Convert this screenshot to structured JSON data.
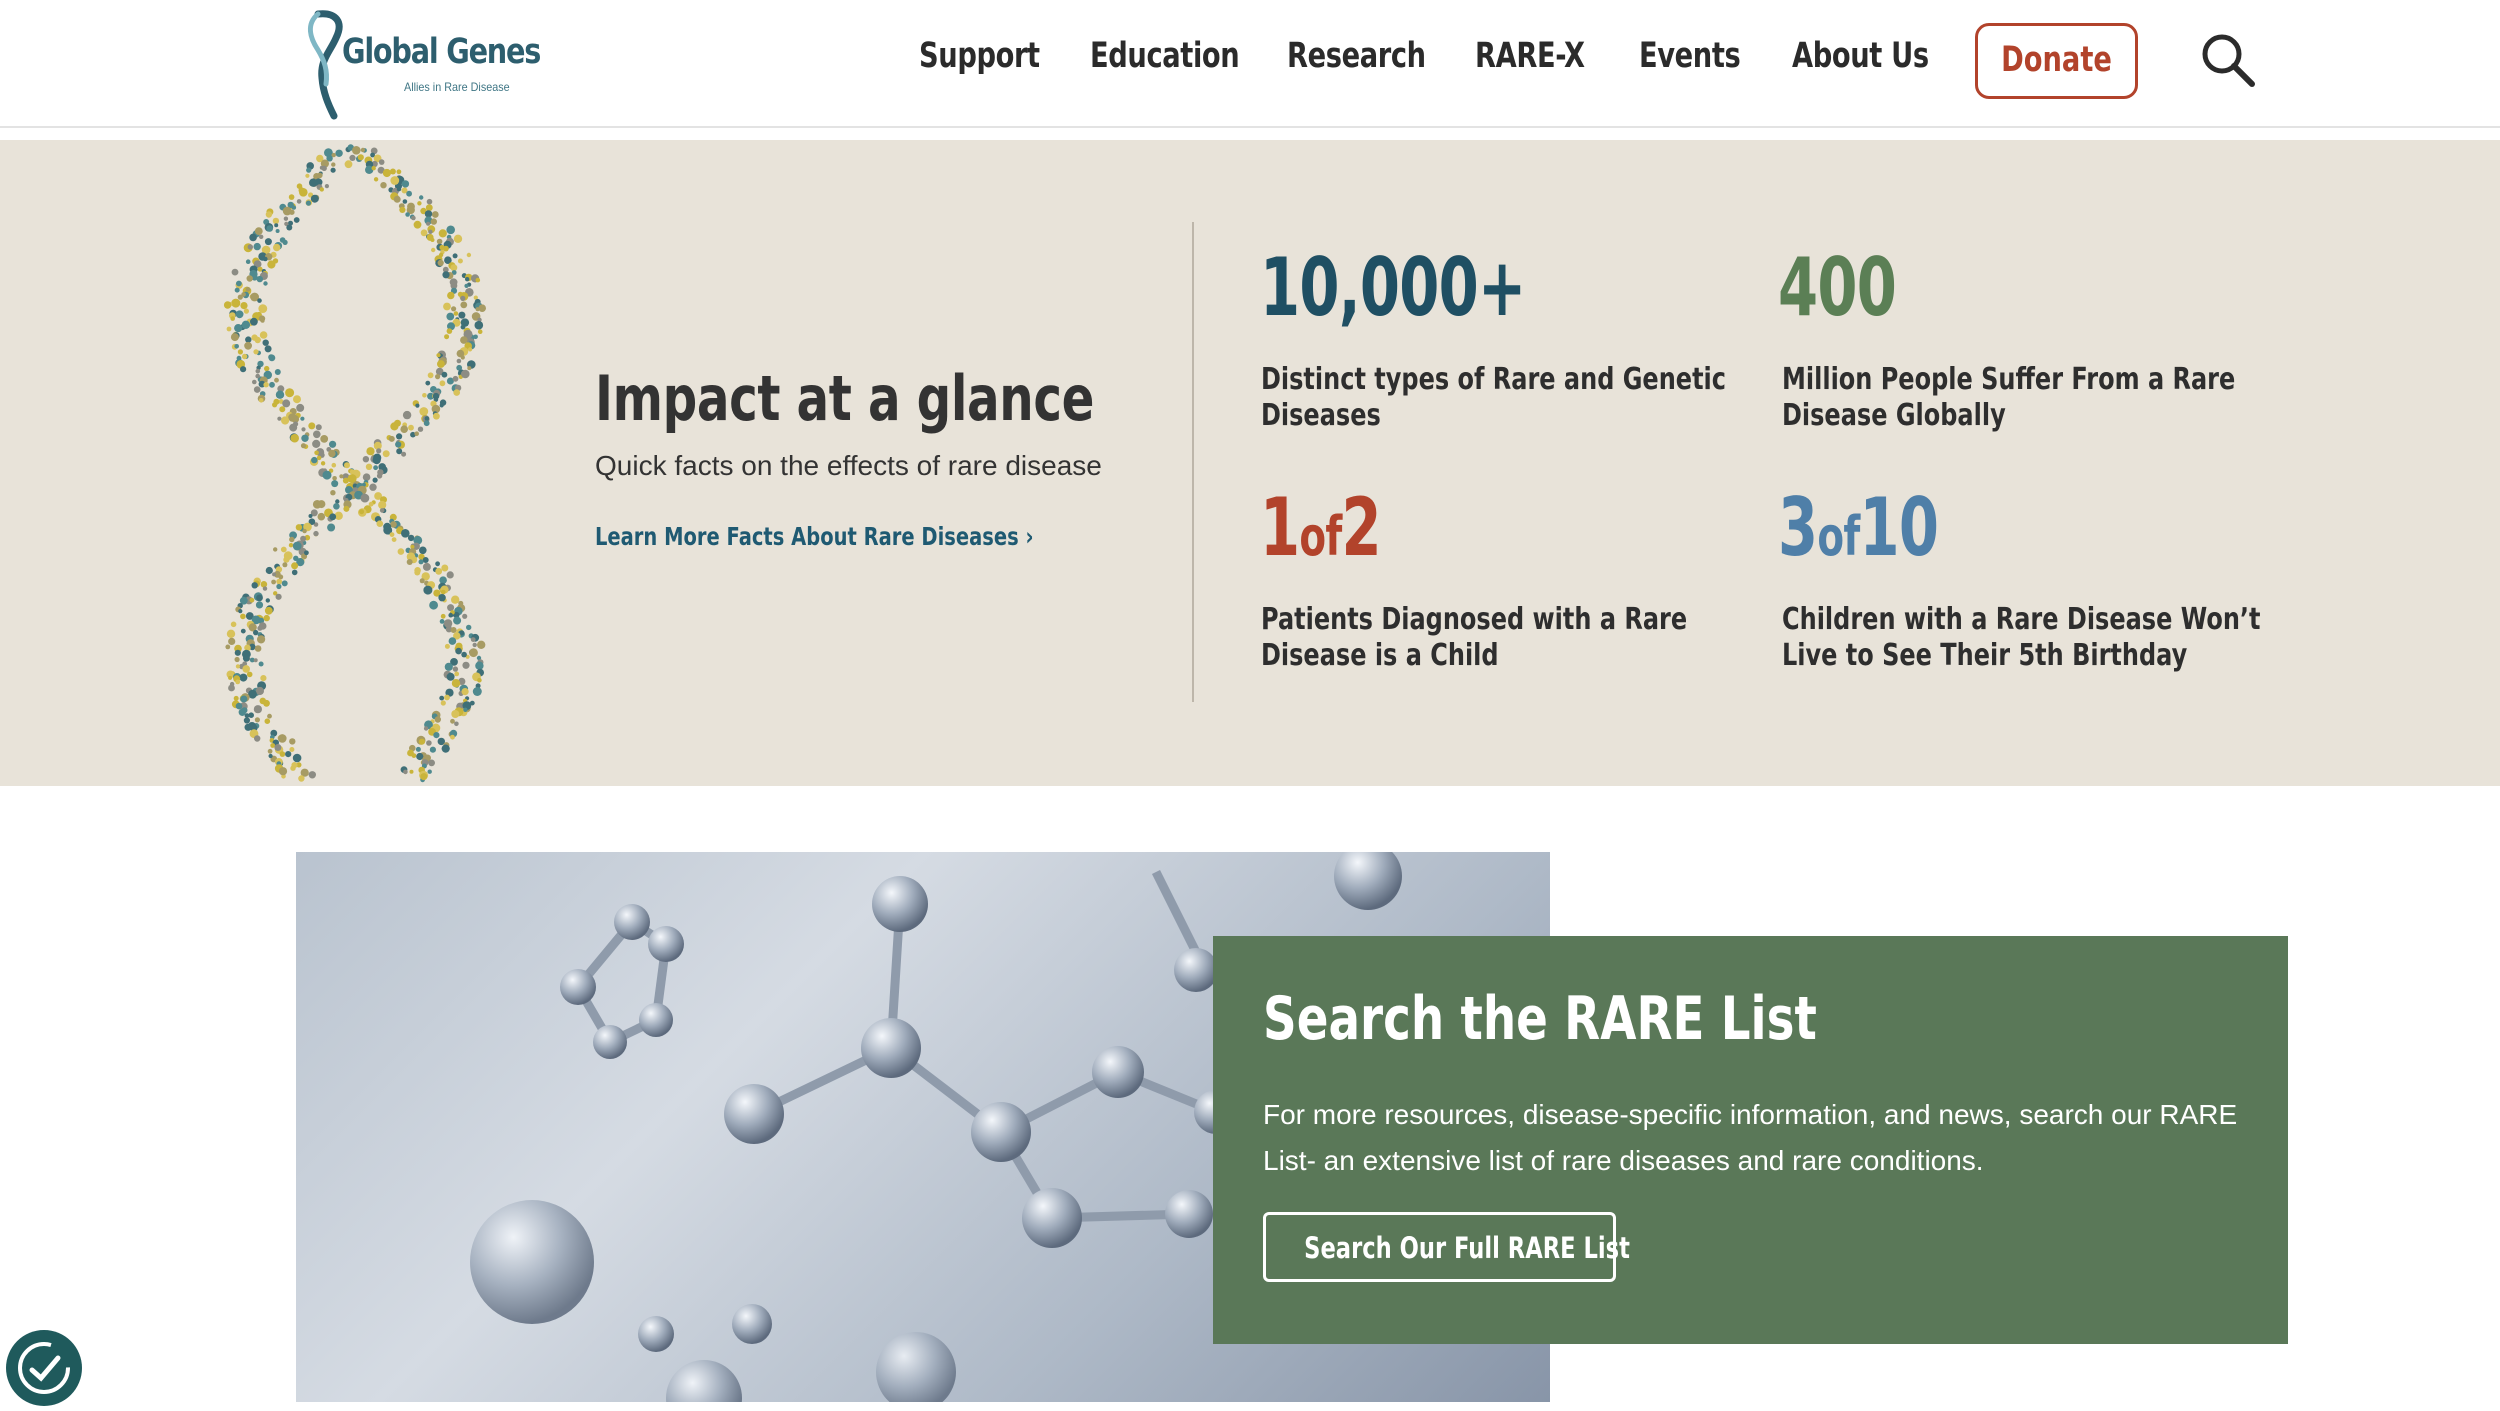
{
  "header": {
    "logo_name": "Global Genes",
    "logo_tagline": "Allies in Rare Disease",
    "nav": [
      "Support",
      "Education",
      "Research",
      "RARE-X",
      "Events",
      "About Us"
    ],
    "donate_label": "Donate",
    "search_icon": "search-icon"
  },
  "impact": {
    "title": "Impact at a glance",
    "subtitle": "Quick facts on the effects of rare disease",
    "link_label": "Learn More Facts About Rare Diseases",
    "stats": [
      {
        "big": "10,000+",
        "label": "Distinct types of Rare and Genetic Diseases",
        "color": "#1f4f63"
      },
      {
        "big": "400",
        "label": "Million People Suffer From a Rare Disease Globally",
        "color": "#5b7f55"
      },
      {
        "big_a": "1",
        "big_of": "of",
        "big_b": "2",
        "label": "Patients Diagnosed with a Rare Disease is a Child",
        "color": "#b2432b"
      },
      {
        "big_a": "3",
        "big_of": "of",
        "big_b": "10",
        "label": "Children with a Rare Disease Won’t Live to See Their 5th Birthday",
        "color": "#4f7fa8"
      }
    ]
  },
  "rare_list": {
    "title": "Search the RARE List",
    "body": "For more resources, disease-specific information, and news,  search our RARE List- an extensive list of rare diseases and rare conditions.",
    "button_label": "Search Our Full RARE List"
  },
  "colors": {
    "brand_teal": "#2d5e6e",
    "donate_red": "#b2432b",
    "band_beige": "#e8e3d9",
    "card_green": "#5a7858"
  }
}
